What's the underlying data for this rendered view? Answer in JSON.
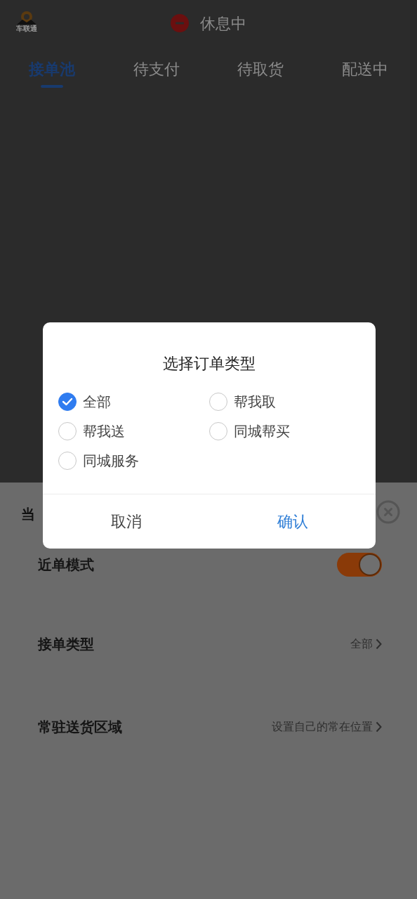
{
  "header": {
    "logo_text": "车联通",
    "status": "休息中"
  },
  "tabs": [
    {
      "label": "接单池",
      "selected": true
    },
    {
      "label": "待支付",
      "selected": false
    },
    {
      "label": "待取货",
      "selected": false
    },
    {
      "label": "配送中",
      "selected": false
    }
  ],
  "settings_sheet": {
    "title": "当",
    "rows": [
      {
        "kind": "toggle",
        "label": "近单模式",
        "on": true
      },
      {
        "kind": "link",
        "label": "接单类型",
        "value": "全部"
      },
      {
        "kind": "link",
        "label": "常驻送货区域",
        "value": "设置自己的常在位置"
      }
    ]
  },
  "dialog": {
    "title": "选择订单类型",
    "options": [
      {
        "label": "全部",
        "selected": true
      },
      {
        "label": "帮我取",
        "selected": false
      },
      {
        "label": "帮我送",
        "selected": false
      },
      {
        "label": "同城帮买",
        "selected": false
      },
      {
        "label": "同城服务",
        "selected": false
      }
    ],
    "buttons": [
      {
        "kind": "cancel",
        "label": "取消"
      },
      {
        "kind": "confirm",
        "label": "确认"
      }
    ]
  }
}
